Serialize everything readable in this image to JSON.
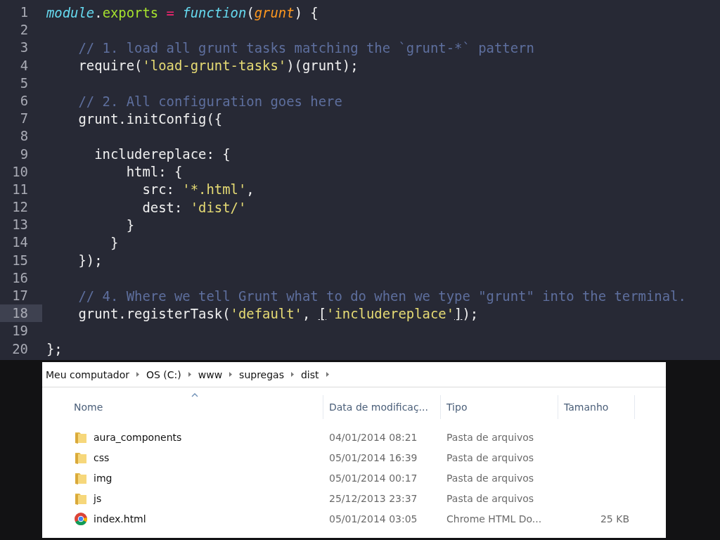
{
  "editor": {
    "lines": [
      {
        "number": "1",
        "current": false,
        "tokens": [
          {
            "kind": "italic",
            "text": "module"
          },
          {
            "kind": "plain",
            "text": "."
          },
          {
            "kind": "method",
            "text": "exports"
          },
          {
            "kind": "operator",
            "text": " = "
          },
          {
            "kind": "italic",
            "text": "function"
          },
          {
            "kind": "plain",
            "text": "("
          },
          {
            "kind": "param",
            "text": "grunt"
          },
          {
            "kind": "plain",
            "text": ") {"
          }
        ]
      },
      {
        "number": "2",
        "current": false
      },
      {
        "number": "3",
        "current": false,
        "tokens": [
          {
            "kind": "comment",
            "text": "    // 1. load all grunt tasks matching the `grunt-*` pattern"
          }
        ]
      },
      {
        "number": "4",
        "current": false,
        "tokens": [
          {
            "kind": "plain",
            "text": "    require("
          },
          {
            "kind": "string",
            "text": "'load-grunt-tasks'"
          },
          {
            "kind": "plain",
            "text": ")(grunt);"
          }
        ]
      },
      {
        "number": "5",
        "current": false
      },
      {
        "number": "6",
        "current": false,
        "tokens": [
          {
            "kind": "comment",
            "text": "    // 2. All configuration goes here"
          }
        ]
      },
      {
        "number": "7",
        "current": false,
        "tokens": [
          {
            "kind": "plain",
            "text": "    grunt.initConfig({"
          }
        ]
      },
      {
        "number": "8",
        "current": false
      },
      {
        "number": "9",
        "current": false,
        "tokens": [
          {
            "kind": "plain",
            "text": "      includereplace: {"
          }
        ]
      },
      {
        "number": "10",
        "current": false,
        "tokens": [
          {
            "kind": "plain",
            "text": "          html: {"
          }
        ]
      },
      {
        "number": "11",
        "current": false,
        "tokens": [
          {
            "kind": "plain",
            "text": "            src: "
          },
          {
            "kind": "string",
            "text": "'*.html'"
          },
          {
            "kind": "plain",
            "text": ","
          }
        ]
      },
      {
        "number": "12",
        "current": false,
        "tokens": [
          {
            "kind": "plain",
            "text": "            dest: "
          },
          {
            "kind": "string",
            "text": "'dist/'"
          }
        ]
      },
      {
        "number": "13",
        "current": false,
        "tokens": [
          {
            "kind": "plain",
            "text": "          }"
          }
        ]
      },
      {
        "number": "14",
        "current": false,
        "tokens": [
          {
            "kind": "plain",
            "text": "        }"
          }
        ]
      },
      {
        "number": "15",
        "current": false,
        "tokens": [
          {
            "kind": "plain",
            "text": "    });"
          }
        ]
      },
      {
        "number": "16",
        "current": false
      },
      {
        "number": "17",
        "current": false,
        "tokens": [
          {
            "kind": "comment",
            "text": "    // 4. Where we tell Grunt what to do when we type \"grunt\" into the terminal."
          }
        ]
      },
      {
        "number": "18",
        "current": true,
        "tokens": [
          {
            "kind": "plain",
            "text": "    grunt.registerTask("
          },
          {
            "kind": "string",
            "text": "'default'"
          },
          {
            "kind": "plain",
            "text": ", "
          },
          {
            "kind": "bracket",
            "text": "["
          },
          {
            "kind": "string",
            "text": "'includereplace'"
          },
          {
            "kind": "bracket",
            "text": "]"
          },
          {
            "kind": "plain",
            "text": ");"
          }
        ]
      },
      {
        "number": "19",
        "current": false
      },
      {
        "number": "20",
        "current": false,
        "tokens": [
          {
            "kind": "plain",
            "text": "};"
          }
        ]
      }
    ]
  },
  "explorer": {
    "breadcrumb": [
      "Meu computador",
      "OS (C:)",
      "www",
      "supregas",
      "dist"
    ],
    "columns": [
      "Nome",
      "Data de modificaç...",
      "Tipo",
      "Tamanho"
    ],
    "rows": [
      {
        "kind": "folder",
        "name": "aura_components",
        "date": "04/01/2014 08:21",
        "type": "Pasta de arquivos"
      },
      {
        "kind": "folder",
        "name": "css",
        "date": "05/01/2014 16:39",
        "type": "Pasta de arquivos"
      },
      {
        "kind": "folder",
        "name": "img",
        "date": "05/01/2014 00:17",
        "type": "Pasta de arquivos"
      },
      {
        "kind": "folder",
        "name": "js",
        "date": "25/12/2013 23:37",
        "type": "Pasta de arquivos"
      },
      {
        "kind": "html",
        "name": "index.html",
        "date": "05/01/2014 03:05",
        "type": "Chrome HTML Do...",
        "size": "25 KB"
      }
    ]
  }
}
